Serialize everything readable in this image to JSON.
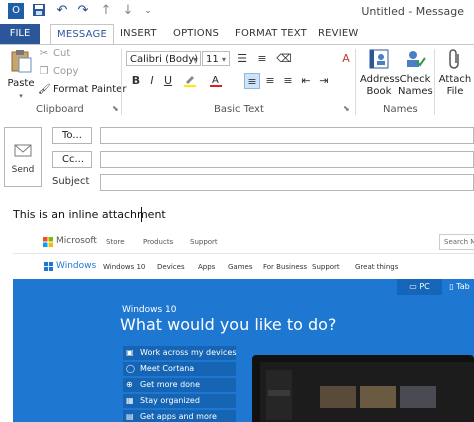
{
  "window": {
    "title": "Untitled - Message",
    "qat_icons": [
      "outlook-icon",
      "save-icon",
      "undo-icon",
      "redo-icon",
      "arrow-up-icon",
      "arrow-down-icon",
      "customize-icon"
    ]
  },
  "tabs": [
    "FILE",
    "MESSAGE",
    "INSERT",
    "OPTIONS",
    "FORMAT TEXT",
    "REVIEW"
  ],
  "ribbon": {
    "clipboard": {
      "label": "Clipboard",
      "paste": "Paste",
      "cut": "Cut",
      "copy": "Copy",
      "format_painter": "Format Painter"
    },
    "basic_text": {
      "label": "Basic Text",
      "font": "Calibri (Body)",
      "size": "11"
    },
    "names": {
      "label": "Names",
      "address_book_1": "Address",
      "address_book_2": "Book",
      "check_names_1": "Check",
      "check_names_2": "Names"
    },
    "include": {
      "attach_1": "Attach",
      "attach_2": "File"
    }
  },
  "compose": {
    "send": "Send",
    "to": "To...",
    "cc": "Cc...",
    "subject": "Subject",
    "body_text": "This is an inline attachment"
  },
  "embedded_page": {
    "brand": "Microsoft",
    "top_nav": [
      "Store",
      "Products",
      "Support"
    ],
    "search_placeholder": "Search Mic",
    "windows_brand": "Windows",
    "win_nav": [
      "Windows 10",
      "Devices",
      "Apps",
      "Games",
      "For Business",
      "Support",
      "Great things"
    ],
    "device_tabs": [
      "PC",
      "Tab"
    ],
    "hero_subtitle": "Windows 10",
    "hero_title": "What would you like to do?",
    "hero_items": [
      "Work across my devices",
      "Meet Cortana",
      "Get more done",
      "Stay organized",
      "Get apps and more"
    ],
    "accent_blue": "#1e78d2"
  }
}
